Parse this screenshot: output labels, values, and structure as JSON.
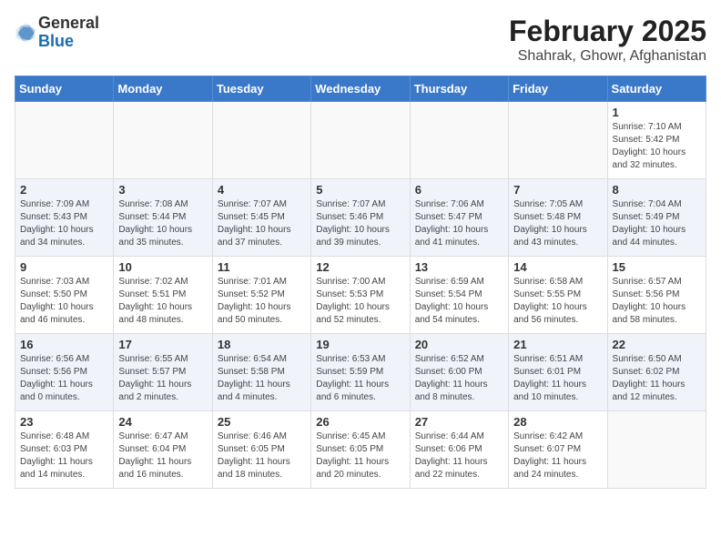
{
  "header": {
    "logo_general": "General",
    "logo_blue": "Blue",
    "month_title": "February 2025",
    "location": "Shahrak, Ghowr, Afghanistan"
  },
  "weekdays": [
    "Sunday",
    "Monday",
    "Tuesday",
    "Wednesday",
    "Thursday",
    "Friday",
    "Saturday"
  ],
  "weeks": [
    [
      {
        "day": "",
        "info": ""
      },
      {
        "day": "",
        "info": ""
      },
      {
        "day": "",
        "info": ""
      },
      {
        "day": "",
        "info": ""
      },
      {
        "day": "",
        "info": ""
      },
      {
        "day": "",
        "info": ""
      },
      {
        "day": "1",
        "info": "Sunrise: 7:10 AM\nSunset: 5:42 PM\nDaylight: 10 hours\nand 32 minutes."
      }
    ],
    [
      {
        "day": "2",
        "info": "Sunrise: 7:09 AM\nSunset: 5:43 PM\nDaylight: 10 hours\nand 34 minutes."
      },
      {
        "day": "3",
        "info": "Sunrise: 7:08 AM\nSunset: 5:44 PM\nDaylight: 10 hours\nand 35 minutes."
      },
      {
        "day": "4",
        "info": "Sunrise: 7:07 AM\nSunset: 5:45 PM\nDaylight: 10 hours\nand 37 minutes."
      },
      {
        "day": "5",
        "info": "Sunrise: 7:07 AM\nSunset: 5:46 PM\nDaylight: 10 hours\nand 39 minutes."
      },
      {
        "day": "6",
        "info": "Sunrise: 7:06 AM\nSunset: 5:47 PM\nDaylight: 10 hours\nand 41 minutes."
      },
      {
        "day": "7",
        "info": "Sunrise: 7:05 AM\nSunset: 5:48 PM\nDaylight: 10 hours\nand 43 minutes."
      },
      {
        "day": "8",
        "info": "Sunrise: 7:04 AM\nSunset: 5:49 PM\nDaylight: 10 hours\nand 44 minutes."
      }
    ],
    [
      {
        "day": "9",
        "info": "Sunrise: 7:03 AM\nSunset: 5:50 PM\nDaylight: 10 hours\nand 46 minutes."
      },
      {
        "day": "10",
        "info": "Sunrise: 7:02 AM\nSunset: 5:51 PM\nDaylight: 10 hours\nand 48 minutes."
      },
      {
        "day": "11",
        "info": "Sunrise: 7:01 AM\nSunset: 5:52 PM\nDaylight: 10 hours\nand 50 minutes."
      },
      {
        "day": "12",
        "info": "Sunrise: 7:00 AM\nSunset: 5:53 PM\nDaylight: 10 hours\nand 52 minutes."
      },
      {
        "day": "13",
        "info": "Sunrise: 6:59 AM\nSunset: 5:54 PM\nDaylight: 10 hours\nand 54 minutes."
      },
      {
        "day": "14",
        "info": "Sunrise: 6:58 AM\nSunset: 5:55 PM\nDaylight: 10 hours\nand 56 minutes."
      },
      {
        "day": "15",
        "info": "Sunrise: 6:57 AM\nSunset: 5:56 PM\nDaylight: 10 hours\nand 58 minutes."
      }
    ],
    [
      {
        "day": "16",
        "info": "Sunrise: 6:56 AM\nSunset: 5:56 PM\nDaylight: 11 hours\nand 0 minutes."
      },
      {
        "day": "17",
        "info": "Sunrise: 6:55 AM\nSunset: 5:57 PM\nDaylight: 11 hours\nand 2 minutes."
      },
      {
        "day": "18",
        "info": "Sunrise: 6:54 AM\nSunset: 5:58 PM\nDaylight: 11 hours\nand 4 minutes."
      },
      {
        "day": "19",
        "info": "Sunrise: 6:53 AM\nSunset: 5:59 PM\nDaylight: 11 hours\nand 6 minutes."
      },
      {
        "day": "20",
        "info": "Sunrise: 6:52 AM\nSunset: 6:00 PM\nDaylight: 11 hours\nand 8 minutes."
      },
      {
        "day": "21",
        "info": "Sunrise: 6:51 AM\nSunset: 6:01 PM\nDaylight: 11 hours\nand 10 minutes."
      },
      {
        "day": "22",
        "info": "Sunrise: 6:50 AM\nSunset: 6:02 PM\nDaylight: 11 hours\nand 12 minutes."
      }
    ],
    [
      {
        "day": "23",
        "info": "Sunrise: 6:48 AM\nSunset: 6:03 PM\nDaylight: 11 hours\nand 14 minutes."
      },
      {
        "day": "24",
        "info": "Sunrise: 6:47 AM\nSunset: 6:04 PM\nDaylight: 11 hours\nand 16 minutes."
      },
      {
        "day": "25",
        "info": "Sunrise: 6:46 AM\nSunset: 6:05 PM\nDaylight: 11 hours\nand 18 minutes."
      },
      {
        "day": "26",
        "info": "Sunrise: 6:45 AM\nSunset: 6:05 PM\nDaylight: 11 hours\nand 20 minutes."
      },
      {
        "day": "27",
        "info": "Sunrise: 6:44 AM\nSunset: 6:06 PM\nDaylight: 11 hours\nand 22 minutes."
      },
      {
        "day": "28",
        "info": "Sunrise: 6:42 AM\nSunset: 6:07 PM\nDaylight: 11 hours\nand 24 minutes."
      },
      {
        "day": "",
        "info": ""
      }
    ]
  ]
}
